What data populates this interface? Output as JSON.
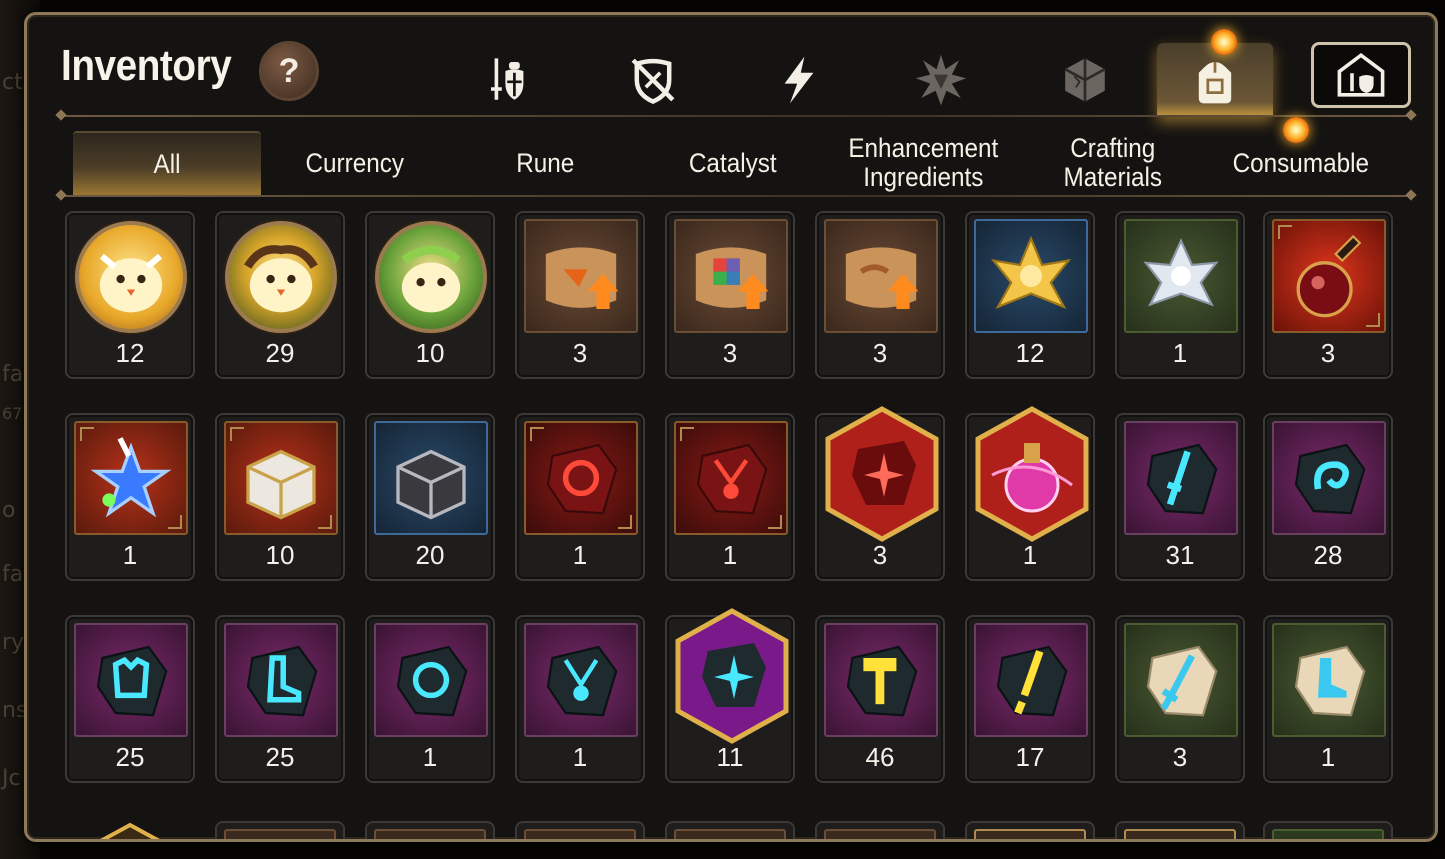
{
  "header": {
    "title": "Inventory",
    "help_label": "?"
  },
  "background_ghost_text": [
    "cts",
    "fa",
    "67",
    "o",
    "fa",
    "ry",
    "ns",
    "Jc"
  ],
  "category_tabs": [
    {
      "name": "equipment",
      "icon": "sword-shield-icon",
      "active": false
    },
    {
      "name": "unequipped",
      "icon": "crossed-shield-icon",
      "active": false
    },
    {
      "name": "artifact",
      "icon": "lightning-icon",
      "active": false
    },
    {
      "name": "exclusive",
      "icon": "burst-emblem-icon",
      "active": false
    },
    {
      "name": "fragment",
      "icon": "cracked-cube-icon",
      "active": false
    },
    {
      "name": "items",
      "icon": "backpack-icon",
      "active": true,
      "notification": true
    },
    {
      "name": "storage",
      "icon": "house-armory-icon",
      "active": false,
      "boxed": true
    }
  ],
  "sub_tabs": [
    {
      "label": "All",
      "active": true
    },
    {
      "label": "Currency",
      "active": false
    },
    {
      "label": "Rune",
      "active": false
    },
    {
      "label": "Catalyst",
      "active": false
    },
    {
      "label": "Enhancement\nIngredients",
      "active": false
    },
    {
      "label": "Crafting\nMaterials",
      "active": false
    },
    {
      "label": "Consumable",
      "active": false,
      "notification": true
    }
  ],
  "colors": {
    "accent_gold": "#c69a3d",
    "notification_orange": "#ffb32a",
    "panel_border": "#8e785a"
  },
  "rows": [
    [
      {
        "icon": "golden-phantasma-circle",
        "count": "12"
      },
      {
        "icon": "green-gold-phantasma-circle",
        "count": "29"
      },
      {
        "icon": "laurel-phantasma-circle",
        "count": "10"
      },
      {
        "icon": "scroll-upgrade-orange",
        "count": "3"
      },
      {
        "icon": "scroll-upgrade-rainbow",
        "count": "3"
      },
      {
        "icon": "scroll-upgrade-plain",
        "count": "3"
      },
      {
        "icon": "golden-lotus-crystal",
        "count": "12"
      },
      {
        "icon": "silver-lotus-crystal",
        "count": "1"
      },
      {
        "icon": "red-potion-flask",
        "count": "3"
      }
    ],
    [
      {
        "icon": "star-potion",
        "count": "1"
      },
      {
        "icon": "white-treasure-box",
        "count": "10"
      },
      {
        "icon": "dark-treasure-box",
        "count": "20"
      },
      {
        "icon": "red-rune-ring",
        "count": "1"
      },
      {
        "icon": "red-rune-necklace",
        "count": "1"
      },
      {
        "icon": "red-hex-rune-star",
        "count": "3"
      },
      {
        "icon": "pink-hex-potion",
        "count": "1"
      },
      {
        "icon": "blue-rune-sword",
        "count": "31"
      },
      {
        "icon": "blue-rune-swirl",
        "count": "28"
      }
    ],
    [
      {
        "icon": "blue-rune-armor",
        "count": "25"
      },
      {
        "icon": "blue-rune-boot",
        "count": "25"
      },
      {
        "icon": "blue-rune-ring",
        "count": "1"
      },
      {
        "icon": "blue-rune-necklace",
        "count": "1"
      },
      {
        "icon": "purple-hex-rune-star",
        "count": "11"
      },
      {
        "icon": "yellow-rune-hammer",
        "count": "46"
      },
      {
        "icon": "yellow-rune-sword",
        "count": "17"
      },
      {
        "icon": "stone-rune-sword",
        "count": "3"
      },
      {
        "icon": "stone-rune-boot",
        "count": "1"
      }
    ]
  ]
}
